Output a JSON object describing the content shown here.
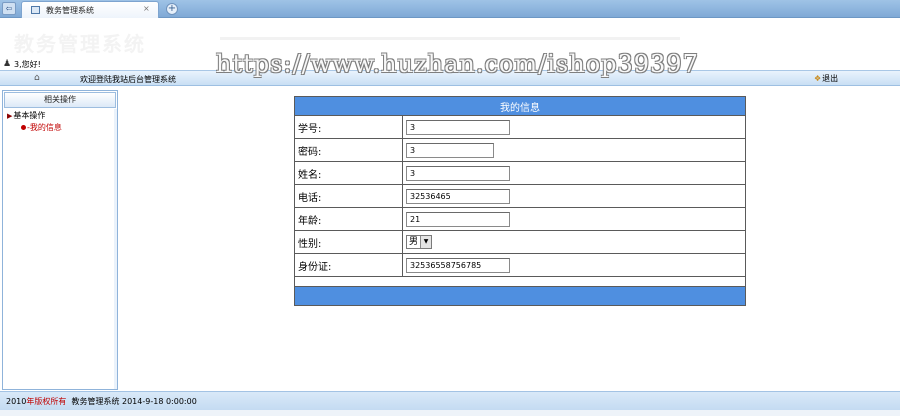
{
  "browser": {
    "tab_title": "教务管理系统",
    "tab_close": "×",
    "new_tab": "+",
    "nav_glyph": "⇦"
  },
  "banner": {
    "logo": "教务管理系统"
  },
  "watermark": "https://www.huzhan.com/ishop39397",
  "user": {
    "greeting": "3,您好!"
  },
  "navbar": {
    "welcome": "欢迎登陆我站后台管理系统",
    "logout": "退出"
  },
  "sidebar": {
    "title": "相关操作",
    "group": "基本操作",
    "item": "-我的信息"
  },
  "form": {
    "title": "我的信息",
    "fields": [
      {
        "label": "学号:",
        "value": "3"
      },
      {
        "label": "密码:",
        "value": "3"
      },
      {
        "label": "姓名:",
        "value": "3"
      },
      {
        "label": "电话:",
        "value": "32536465"
      },
      {
        "label": "年龄:",
        "value": "21"
      },
      {
        "label": "性别:",
        "value": "男"
      },
      {
        "label": "身份证:",
        "value": "32536558756785"
      }
    ]
  },
  "footer": {
    "year": "2010",
    "rights": "年版权所有",
    "system": "教务管理系统",
    "date": "2014-9-18 0:00:00"
  },
  "colors": {
    "header_blue": "#4f8fe0",
    "sidebar_active": "#c00000"
  }
}
